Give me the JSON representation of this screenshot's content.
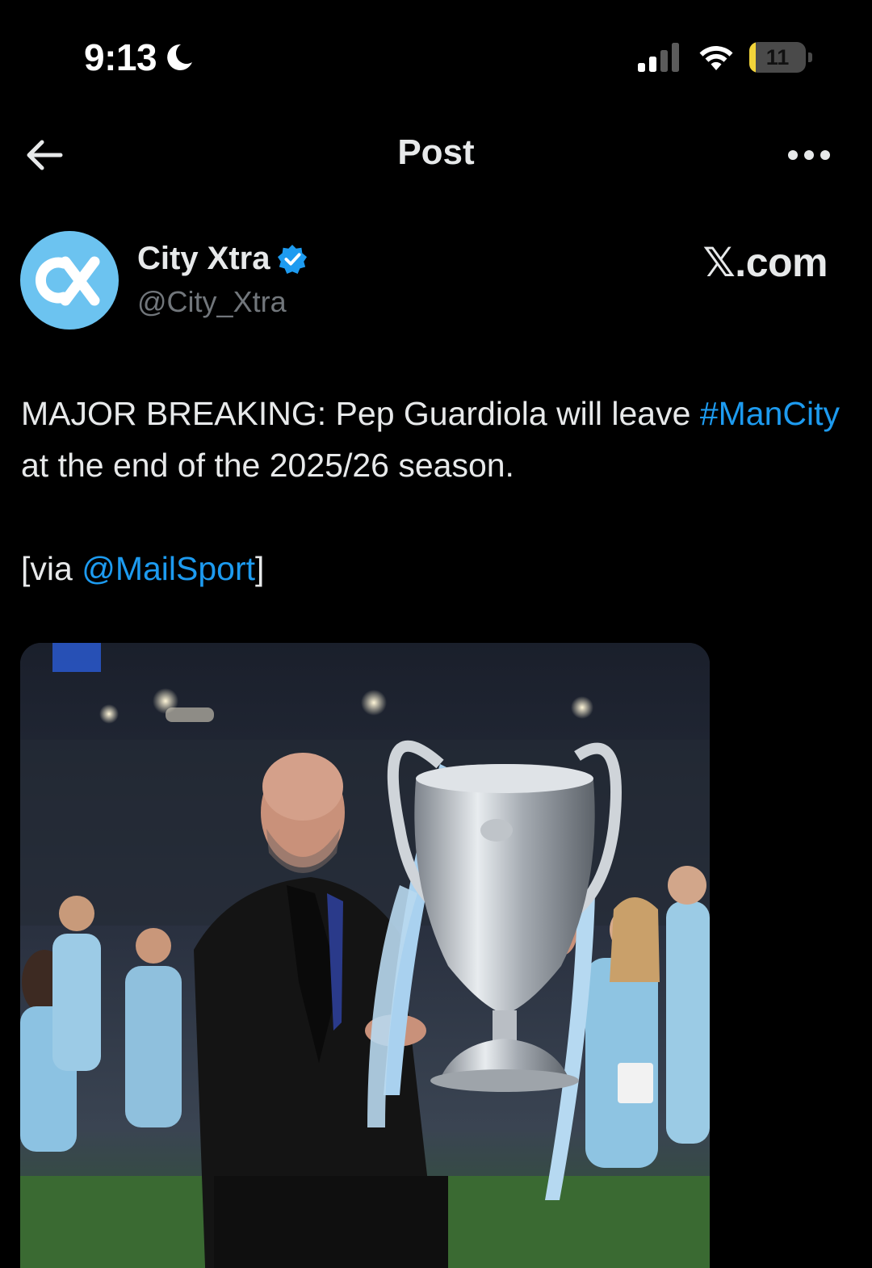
{
  "status_bar": {
    "time": "9:13",
    "battery_level": "11",
    "battery_fraction": 0.11,
    "focus_icon": "moon-icon",
    "signal_icon": "cellular-signal-icon",
    "wifi_icon": "wifi-icon"
  },
  "header": {
    "title": "Post",
    "back_icon": "arrow-left-icon",
    "more_icon": "more-horizontal-icon"
  },
  "author": {
    "display_name": "City Xtra",
    "handle": "@City_Xtra",
    "avatar_letters": "CX",
    "verified": true,
    "watermark": "𝕏.com"
  },
  "post": {
    "text_before": "MAJOR BREAKING: Pep Guardiola will leave ",
    "hashtag": "#ManCity",
    "text_after": " at the end of the 2025/26 season.",
    "via_prefix": "[via ",
    "mention": "@MailSport",
    "via_suffix": "]"
  },
  "media": {
    "type": "photo"
  },
  "colors": {
    "background": "#000000",
    "text": "#e7e9ea",
    "secondary_text": "#71767b",
    "link": "#1d9bf0",
    "verified_badge": "#1d9bf0",
    "avatar_bg": "#6cc3f0",
    "battery": "#f2d43a"
  }
}
